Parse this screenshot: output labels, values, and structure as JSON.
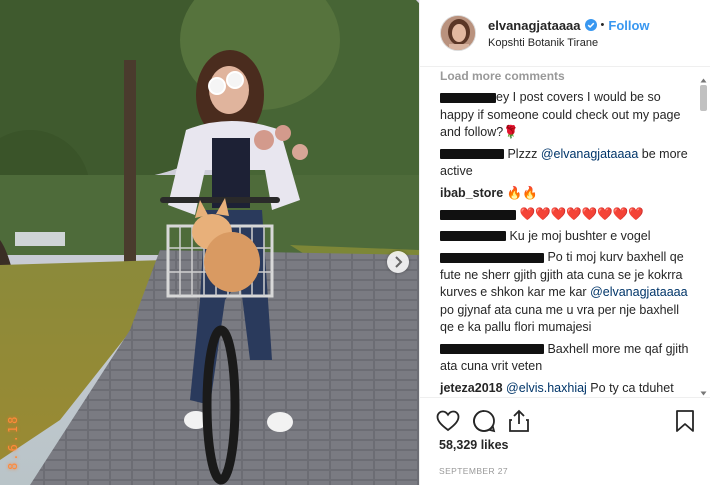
{
  "photo": {
    "date_stamp": "8.6.18",
    "next_icon": "chevron-right-icon"
  },
  "post_header": {
    "username": "elvanagjataaaa",
    "verified_icon": "verified-badge-icon",
    "separator": "•",
    "follow_label": "Follow",
    "location": "Kopshti Botanik Tirane"
  },
  "comments": {
    "load_more": "Load more comments",
    "items": [
      {
        "user": "",
        "text": "ey I post covers I would be so happy if someone could check out my page and follow?🌹"
      },
      {
        "user": "",
        "text": " Plzzz ",
        "mention": "@elvanagjataaaa",
        "text_after": " be more active"
      },
      {
        "user": "ibab_store",
        "text": " 🔥🔥"
      },
      {
        "user": "",
        "text": " ❤️❤️❤️❤️❤️❤️❤️❤️"
      },
      {
        "user": "",
        "text": " Ku je moj bushter e vogel"
      },
      {
        "user": "",
        "text": " Po ti moj kurv baxhell qe fute ne sherr gjith gjith ata cuna se je kokrra kurves e shkon kar me kar ",
        "mention": "@elvanagjataaaa",
        "text_after": " po gjynaf ata cuna me u vra per nje baxhell qe e ka pallu flori mumajesi"
      },
      {
        "user": "",
        "text": " Baxhell more me qaf gjith ata cuna vrit veten"
      },
      {
        "user": "jeteza2018",
        "text": " ",
        "mention": "@elvis.haxhiaj",
        "text_after": " Po ty ca tduhet eli?"
      }
    ]
  },
  "actions": {
    "like_icon": "heart-icon",
    "comment_icon": "comment-icon",
    "share_icon": "share-icon",
    "save_icon": "bookmark-icon",
    "likes": "58,329 likes",
    "date": "SEPTEMBER 27"
  },
  "colors": {
    "link": "#3897f0",
    "mention": "#003569",
    "muted": "#999999",
    "text": "#262626"
  }
}
